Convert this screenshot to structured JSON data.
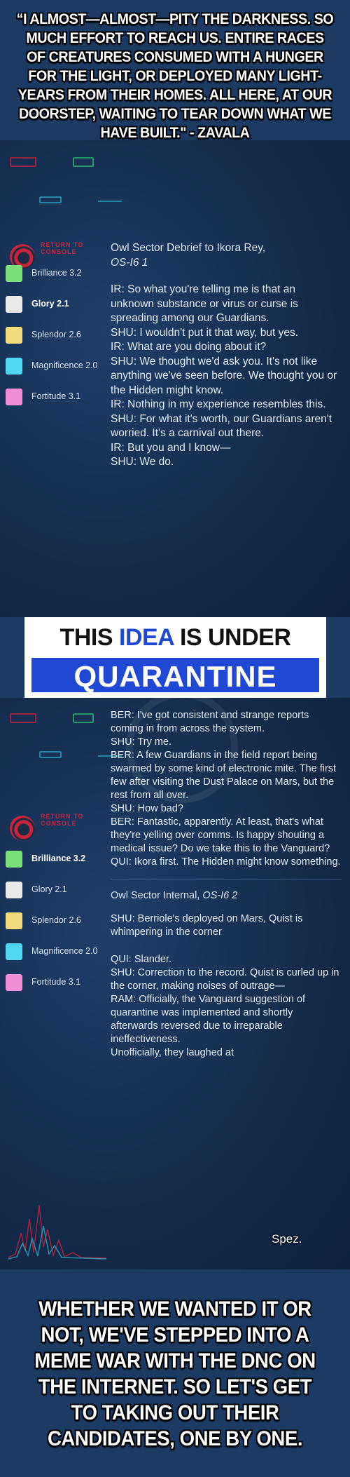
{
  "top_caption": "“I ALMOST—ALMOST—PITY THE DARKNESS. SO MUCH EFFORT TO REACH US. ENTIRE RACES OF CREATURES CONSUMED WITH A HUNGER FOR THE LIGHT, OR DEPLOYED MANY LIGHT-YEARS FROM THEIR HOMES. ALL HERE, AT OUR DOORSTEP, WAITING TO TEAR DOWN WHAT WE HAVE BUILT.\" - ZAVALA",
  "panel_1": {
    "return_label": "RETURN TO CONSOLE",
    "list": [
      {
        "label": "Brilliance 3.2",
        "color": "#7be07a",
        "bold": false
      },
      {
        "label": "Glory 2.1",
        "color": "#e9e9ea",
        "bold": true
      },
      {
        "label": "Splendor 2.6",
        "color": "#f4dc7e",
        "bold": false
      },
      {
        "label": "Magnificence 2.0",
        "color": "#4fd6f2",
        "bold": false
      },
      {
        "label": "Fortitude 3.1",
        "color": "#f08fd6",
        "bold": false
      }
    ],
    "title_line1": "Owl Sector Debrief to Ikora Rey,",
    "title_line2": "OS-I6 1",
    "dialog": "IR: So what you're telling me is that an unknown substance or virus or curse is spreading among our Guardians.\nSHU: I wouldn't put it that way, but yes.\nIR: What are you doing about it?\nSHU: We thought we'd ask you. It's not like anything we've seen before. We thought you or the Hidden might know.\nIR: Nothing in my experience resembles this.\nSHU: For what it's worth, our Guardians aren't worried. It's a carnival out there.\nIR: But you and I know—\nSHU: We do."
  },
  "banner": {
    "line1_a": "THIS",
    "line1_b": "IDEA",
    "line1_c": "IS UNDER",
    "line2": "QUARANTINE"
  },
  "panel_2": {
    "return_label": "RETURN TO CONSOLE",
    "list": [
      {
        "label": "Brilliance 3.2",
        "color": "#7be07a",
        "bold": true
      },
      {
        "label": "Glory 2.1",
        "color": "#e9e9ea",
        "bold": false
      },
      {
        "label": "Splendor 2.6",
        "color": "#f4dc7e",
        "bold": false
      },
      {
        "label": "Magnificence 2.0",
        "color": "#4fd6f2",
        "bold": false
      },
      {
        "label": "Fortitude 3.1",
        "color": "#f08fd6",
        "bold": false
      }
    ],
    "dialog_1": "BER: I've got consistent and strange reports coming in from across the system.\nSHU: Try me.\nBER: A few Guardians in the field report being swarmed by some kind of electronic mite. The first few after visiting the Dust Palace on Mars, but the rest from all over.\nSHU: How bad?\nBER: Fantastic, apparently. At least, that's what they're yelling over comms. Is happy shouting a medical issue? Do we take this to the Vanguard?\nQUI: Ikora first. The Hidden might know something.",
    "title_a": "Owl Sector Internal, ",
    "title_b": "OS-I6 2",
    "dialog_2a": "SHU: Berriole's deployed on Mars, Quist is whimpering in the corner",
    "dialog_2b": "QUI: Slander.\nSHU: Correction to the record. Quist is curled up in the corner, making noises of outrage—\nRAM: Officially, the Vanguard suggestion of quarantine was implemented and shortly afterwards reversed due to irreparable ineffectiveness.\nUnofficially, they laughed at",
    "spez": "Spez."
  },
  "bottom_caption": "WHETHER WE WANTED IT OR NOT, WE'VE STEPPED INTO A MEME WAR WITH THE DNC ON THE INTERNET. SO LET'S GET TO TAKING OUT THEIR CANDIDATES, ONE BY ONE."
}
